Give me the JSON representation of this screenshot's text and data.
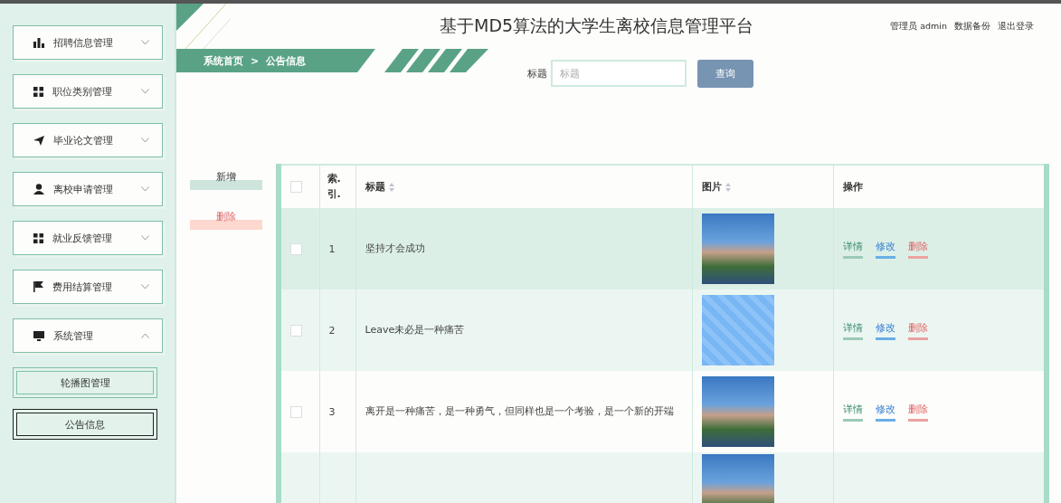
{
  "header": {
    "title": "基于MD5算法的大学生离校信息管理平台",
    "user_links": [
      "管理员 admin",
      "数据备份",
      "退出登录"
    ]
  },
  "sidebar": {
    "menus": [
      {
        "label": "招聘信息管理",
        "kind": "chart",
        "expanded": false
      },
      {
        "label": "职位类别管理",
        "kind": "grid",
        "expanded": false
      },
      {
        "label": "毕业论文管理",
        "kind": "send",
        "expanded": false
      },
      {
        "label": "离校申请管理",
        "kind": "user",
        "expanded": false
      },
      {
        "label": "就业反馈管理",
        "kind": "grid",
        "expanded": false
      },
      {
        "label": "费用结算管理",
        "kind": "flag",
        "expanded": false
      },
      {
        "label": "系统管理",
        "kind": "monitor",
        "expanded": true,
        "children": [
          {
            "label": "轮播图管理",
            "selected": false
          },
          {
            "label": "公告信息",
            "selected": true
          }
        ]
      }
    ]
  },
  "breadcrumb": {
    "items": [
      "系统首页",
      "公告信息"
    ],
    "separator": ">"
  },
  "search": {
    "label": "标题",
    "placeholder": "标题",
    "button": "查询"
  },
  "actions": [
    {
      "label": "新增",
      "kind": "add"
    },
    {
      "label": "删除",
      "kind": "delete"
    }
  ],
  "table": {
    "columns": [
      {
        "kind": "checkbox",
        "checked": false
      },
      {
        "kind": "index",
        "label": "索.引."
      },
      {
        "kind": "title",
        "label": "标题",
        "sortable": true
      },
      {
        "kind": "image",
        "label": "图片",
        "sortable": true
      },
      {
        "kind": "actions",
        "label": "操作",
        "sortable": false
      }
    ],
    "rows": [
      {
        "kind": "full",
        "checked": false,
        "hovered": true,
        "index": "1",
        "title": "坚持才会成功",
        "links": [
          {
            "label": "详情",
            "kind": "detail"
          },
          {
            "label": "修改",
            "kind": "edit"
          },
          {
            "label": "删除",
            "kind": "delete"
          }
        ]
      },
      {
        "kind": "full",
        "checked": false,
        "hovered": false,
        "index": "2",
        "title": "Leave未必是一种痛苦",
        "links": [
          {
            "label": "详情",
            "kind": "detail"
          },
          {
            "label": "修改",
            "kind": "edit"
          },
          {
            "label": "删除",
            "kind": "delete"
          }
        ]
      },
      {
        "kind": "full",
        "checked": false,
        "hovered": false,
        "index": "3",
        "title": "离开是一种痛苦，是一种勇气，但同样也是一个考验，是一个新的开端",
        "links": [
          {
            "label": "详情",
            "kind": "detail"
          },
          {
            "label": "修改",
            "kind": "edit"
          },
          {
            "label": "删除",
            "kind": "delete"
          }
        ]
      },
      {
        "kind": "cut",
        "hovered": false
      }
    ]
  }
}
